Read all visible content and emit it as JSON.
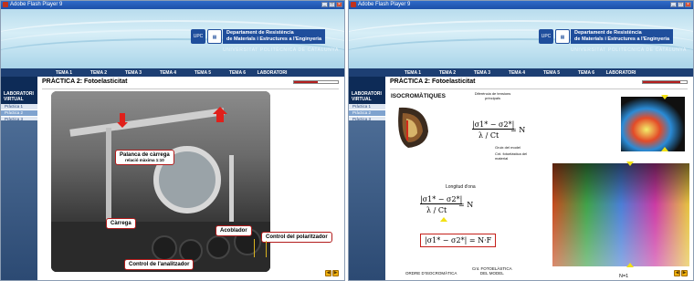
{
  "window1": {
    "title": "Adobe Flash Player 9",
    "header": {
      "dept_line1": "Departament de Resistència",
      "dept_line2": "de Materials i Estructures a l'Enginyeria",
      "university": "UNIVERSITAT POLITÈCNICA DE CATALUNYA",
      "logo_text": "UPC"
    },
    "nav": [
      "TEMA 1",
      "TEMA 2",
      "TEMA 3",
      "TEMA 4",
      "TEMA 5",
      "TEMA 6",
      "LABORATORI"
    ],
    "sidebar": {
      "heading": "LABORATORI VIRTUAL",
      "items": [
        "Pràctica 1",
        "Pràctica 2",
        "Pràctica 3"
      ],
      "active_index": 1
    },
    "page_title": "PRÀCTICA 2: Fotoelasticitat",
    "progress": 0.55,
    "callouts": {
      "lever": "Palanca de càrrega",
      "lever_sub": "relació màxima 1:10",
      "load": "Càrrega",
      "coupler": "Acoblador",
      "polarizer": "Control del polaritzador",
      "analyzer": "Control de l'analitzador"
    },
    "nav_buttons": [
      "◀",
      "▶"
    ]
  },
  "window2": {
    "title": "Adobe Flash Player 9",
    "header": {
      "dept_line1": "Departament de Resistència",
      "dept_line2": "de Materials i Estructures a l'Enginyeria",
      "university": "UNIVERSITAT POLITÈCNICA DE CATALUNYA",
      "logo_text": "UPC"
    },
    "nav": [
      "TEMA 1",
      "TEMA 2",
      "TEMA 3",
      "TEMA 4",
      "TEMA 5",
      "TEMA 6",
      "LABORATORI"
    ],
    "sidebar": {
      "heading": "LABORATORI VIRTUAL",
      "items": [
        "Pràctica 1",
        "Pràctica 2",
        "Pràctica 3"
      ],
      "active_index": 1
    },
    "page_title": "PRÀCTICA 2: Fotoelasticitat",
    "progress": 0.85,
    "section_heading": "ISOCROMÀTIQUES",
    "annotations": {
      "principal_stress_diff": "Diferència de tensions principals",
      "model_thickness": "Gruix del model",
      "material_constant": "Cnt. fotoelàstica del material",
      "wavelength": "Longitud d'ona",
      "isochromatic_order": "ORDRE D'ISOCROMÀTICA",
      "model_constant_line1": "Cnt. FOTOELÀSTICA",
      "model_constant_line2": "DEL MODEL",
      "n1": "N=1"
    },
    "formulas": {
      "top_numerator": "|σ1* − σ2*|",
      "top_denominator": "λ / Ct",
      "top_rhs": "= N",
      "mid_numerator": "|σ1* − σ2*|",
      "mid_denominator": "λ / Ct",
      "mid_rhs": "= N",
      "boxed": "|σ1* − σ2*| = N·F"
    },
    "nav_buttons": [
      "◀",
      "▶"
    ]
  }
}
